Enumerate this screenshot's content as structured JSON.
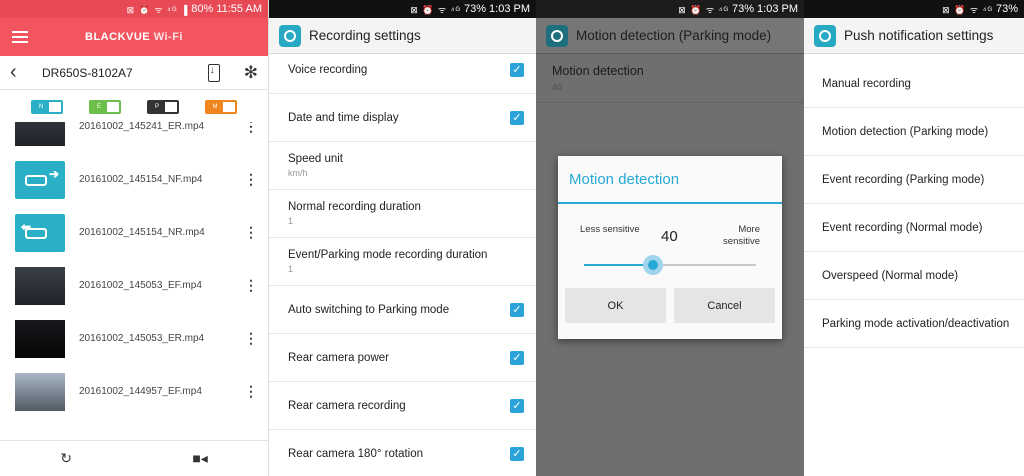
{
  "panel1": {
    "status_time": "11:55 AM",
    "status_battery": "80%",
    "status_icons": "⊠ ⏰ ᯤ ⁴ᴳ ▐",
    "brand": "BLACKVUE",
    "brand_suffix": "Wi-Fi",
    "device_name": "DR650S-8102A7",
    "filters": [
      {
        "label": "N",
        "color": "#2ab0c6"
      },
      {
        "label": "E",
        "color": "#6cc04a"
      },
      {
        "label": "P",
        "color": "#333333"
      },
      {
        "label": "M",
        "color": "#f0851e"
      }
    ],
    "files": [
      {
        "name": "20161002_145241_ER.mp4",
        "thumb": "dark"
      },
      {
        "name": "20161002_145154_NF.mp4",
        "thumb": "car-front"
      },
      {
        "name": "20161002_145154_NR.mp4",
        "thumb": "car-rear"
      },
      {
        "name": "20161002_145053_EF.mp4",
        "thumb": "dark"
      },
      {
        "name": "20161002_145053_ER.mp4",
        "thumb": "darker"
      },
      {
        "name": "20161002_144957_EF.mp4",
        "thumb": "light"
      }
    ],
    "icons": {
      "menu": "hamburger-icon",
      "back": "back-arrow-icon",
      "download": "phone-download-icon",
      "settings": "gear-icon",
      "refresh": "refresh-icon",
      "video": "video-camera-icon"
    }
  },
  "panel2": {
    "status_time": "1:03 PM",
    "status_battery": "73%",
    "title": "Recording settings",
    "settings": [
      {
        "title": "Voice recording",
        "value": "",
        "checked": true
      },
      {
        "title": "Date and time display",
        "value": "",
        "checked": true
      },
      {
        "title": "Speed unit",
        "value": "km/h",
        "checked": false
      },
      {
        "title": "Normal recording duration",
        "value": "1",
        "checked": false
      },
      {
        "title": "Event/Parking mode recording duration",
        "value": "1",
        "checked": false
      },
      {
        "title": "Auto switching to Parking mode",
        "value": "",
        "checked": true
      },
      {
        "title": "Rear camera power",
        "value": "",
        "checked": true
      },
      {
        "title": "Rear camera recording",
        "value": "",
        "checked": true
      },
      {
        "title": "Rear camera 180° rotation",
        "value": "",
        "checked": true
      }
    ]
  },
  "panel3": {
    "status_time": "1:03 PM",
    "status_battery": "73%",
    "title": "Motion detection (Parking mode)",
    "item_title": "Motion detection",
    "item_value": "40",
    "dialog": {
      "title": "Motion detection",
      "less_label": "Less sensitive",
      "more_label_line1": "More",
      "more_label_line2": "sensitive",
      "value": "40",
      "slider_fraction": 0.4,
      "ok": "OK",
      "cancel": "Cancel"
    }
  },
  "panel4": {
    "status_battery": "73%",
    "title": "Push notification settings",
    "items": [
      "Manual recording",
      "Motion detection (Parking mode)",
      "Event recording (Parking mode)",
      "Event recording (Normal mode)",
      "Overspeed (Normal mode)",
      "Parking mode activation/deactivation"
    ]
  },
  "colors": {
    "accent": "#27a9d6",
    "brand_red": "#f25560",
    "check": "#2aa3d8"
  }
}
